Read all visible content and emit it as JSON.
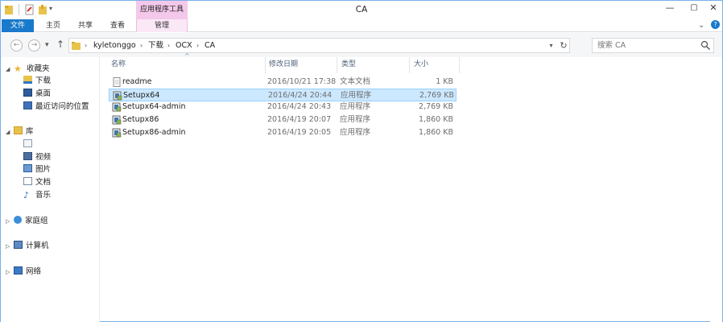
{
  "window": {
    "title": "CA",
    "context_group": "应用程序工具"
  },
  "ribbon": {
    "tabs": [
      "文件",
      "主页",
      "共享",
      "查看",
      "管理"
    ]
  },
  "address": {
    "breadcrumbs": [
      "kyletonggo",
      "下载",
      "OCX",
      "CA"
    ],
    "search_placeholder": "搜索 CA"
  },
  "nav": {
    "favorites": {
      "label": "收藏夹",
      "items": [
        "下载",
        "桌面",
        "最近访问的位置"
      ]
    },
    "libraries": {
      "label": "库",
      "items": [
        "",
        "视频",
        "图片",
        "文档",
        "音乐"
      ]
    },
    "homegroup": "家庭组",
    "computer": "计算机",
    "network": "网络"
  },
  "columns": {
    "name": "名称",
    "date": "修改日期",
    "type": "类型",
    "size": "大小"
  },
  "files": [
    {
      "name": "readme",
      "date": "2016/10/21 17:38",
      "type": "文本文档",
      "size": "1 KB",
      "icon": "text-file-icon",
      "selected": false
    },
    {
      "name": "Setupx64",
      "date": "2016/4/24 20:44",
      "type": "应用程序",
      "size": "2,769 KB",
      "icon": "installer-icon",
      "selected": true
    },
    {
      "name": "Setupx64-admin",
      "date": "2016/4/24 20:43",
      "type": "应用程序",
      "size": "2,769 KB",
      "icon": "installer-icon",
      "selected": false
    },
    {
      "name": "Setupx86",
      "date": "2016/4/19 20:07",
      "type": "应用程序",
      "size": "1,860 KB",
      "icon": "installer-icon",
      "selected": false
    },
    {
      "name": "Setupx86-admin",
      "date": "2016/4/19 20:05",
      "type": "应用程序",
      "size": "1,860 KB",
      "icon": "installer-icon",
      "selected": false
    }
  ],
  "colors": {
    "file_tab": "#1979ca",
    "context_tab": "#f3c8ea",
    "selection": "#cce8ff"
  }
}
